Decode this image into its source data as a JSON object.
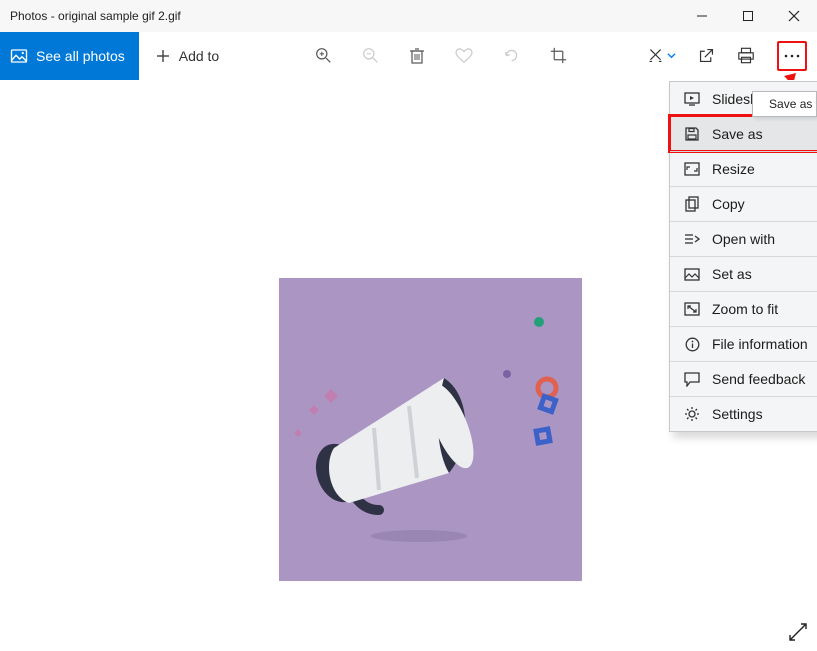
{
  "window": {
    "title": "Photos - original sample gif 2.gif"
  },
  "toolbar": {
    "see_all_label": "See all photos",
    "add_to_label": "Add to"
  },
  "tooltip": {
    "text": "Save as (Ctrl"
  },
  "menu": {
    "items": [
      {
        "label": "Slideshow"
      },
      {
        "label": "Save as"
      },
      {
        "label": "Resize"
      },
      {
        "label": "Copy"
      },
      {
        "label": "Open with"
      },
      {
        "label": "Set as"
      },
      {
        "label": "Zoom to fit"
      },
      {
        "label": "File information"
      },
      {
        "label": "Send feedback"
      },
      {
        "label": "Settings"
      }
    ]
  }
}
